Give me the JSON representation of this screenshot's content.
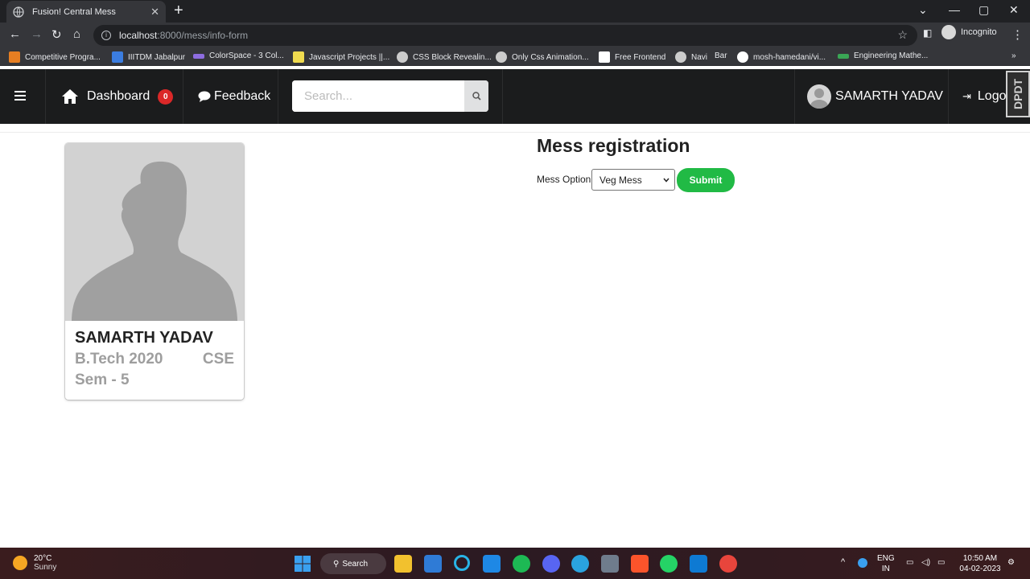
{
  "browser": {
    "tab_title": "Fusion! Central Mess",
    "tab_close": "✕",
    "new_tab": "+",
    "url_host": "localhost",
    "url_rest": ":8000/mess/info-form",
    "mode_label": "Incognito",
    "bookmarks": [
      {
        "label": "Competitive Progra...",
        "color": "#e67e22"
      },
      {
        "label": "IIITDM Jabalpur",
        "color": "#3b7de0"
      },
      {
        "label": "ColorSpace - 3 Col...",
        "color": "#8e6de0"
      },
      {
        "label": "Javascript Projects ||...",
        "color": "#f0db4f"
      },
      {
        "label": "CSS Block Revealin...",
        "color": "#cccccc"
      },
      {
        "label": "Only Css Animation...",
        "color": "#cccccc"
      },
      {
        "label": "Free Frontend",
        "color": "#ffffff"
      },
      {
        "label": "Navi",
        "color": "#cccccc"
      },
      {
        "label": "Bar",
        "color": "#35363a"
      },
      {
        "label": "mosh-hamedani/vi...",
        "color": "#ffffff"
      },
      {
        "label": "Engineering Mathe...",
        "color": "#3aa655"
      }
    ],
    "bookmarks_more": "»"
  },
  "navbar": {
    "dashboard_label": "Dashboard",
    "notification_count": "0",
    "feedback_label": "Feedback",
    "search_placeholder": "Search...",
    "user_name": "SAMARTH YADAV",
    "logout_label": "Logout",
    "extension_label": "DPDT",
    "accent_badge": "#db2828"
  },
  "profile": {
    "name": "SAMARTH YADAV",
    "program": "B.Tech 2020",
    "branch": "CSE",
    "semester": "Sem - 5"
  },
  "form": {
    "title": "Mess registration",
    "option_label": "Mess Option:",
    "selected_option": "Veg Mess",
    "submit_label": "Submit",
    "submit_color": "#21ba45"
  },
  "taskbar": {
    "temperature": "20°C",
    "condition": "Sunny",
    "search_label": "Search",
    "lang_top": "ENG",
    "lang_bottom": "IN",
    "time": "10:50 AM",
    "date": "04-02-2023"
  }
}
